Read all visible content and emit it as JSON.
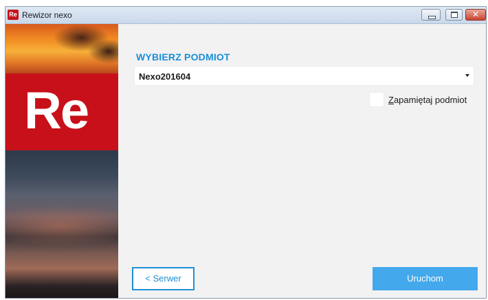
{
  "window": {
    "title": "Rewizor nexo",
    "app_icon_text": "Re",
    "close_glyph": "✕"
  },
  "sidebar": {
    "brand_text": "Re",
    "brand_color": "#c8101a"
  },
  "main": {
    "heading": "WYBIERZ PODMIOT",
    "select": {
      "value": "Nexo201604"
    },
    "remember": {
      "label_underlined": "Z",
      "label_rest": "apamiętaj podmiot",
      "checked": false
    },
    "buttons": {
      "server_label": "< Serwer",
      "run_label": "Uruchom"
    },
    "accent_color": "#1a8ed8"
  }
}
